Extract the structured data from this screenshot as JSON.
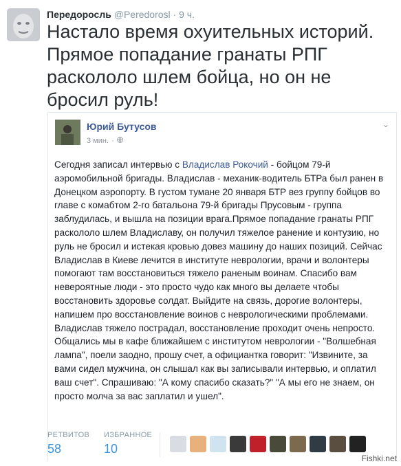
{
  "tweet": {
    "author_name": "Передоросль",
    "author_handle": "@Peredorosl",
    "separator": "·",
    "time": "9 ч.",
    "text": "Настало время охуительных историй. Прямое попадание гранаты РПГ раскололо шлем бойца, но он не бросил руль!"
  },
  "screenshot": {
    "author": "Юрий Бутусов",
    "time": "3 мин.",
    "dot": "·",
    "globe_icon": "globe-icon",
    "chevron": "⌄",
    "body_before_link": "Сегодня записал интервью с ",
    "link": "Владислав Рокочий",
    "body_after_link": " - бойцом 79-й аэромобильной бригады. Владислав - механик-водитель БТРа был ранен в Донецком аэропорту. В густом тумане 20 января БТР вез группу бойцов во главе с комабтом 2-го батальона 79-й бригады Прусовым - группа заблудилась, и вышла на позиции врага.Прямое попадание гранаты РПГ раскололо шлем Владиславу, он получил тяжелое ранение и контузию, но руль не бросил и истекая кровью довез машину до наших позиций. Сейчас Владислав в Киеве лечится в институте неврологии, врачи и волонтеры помогают там восстановиться тяжело раненым воинам. Спасибо вам невероятные люди - это просто чудо как много вы делаете чтобы восстановить здоровье солдат. Выйдите на связь, дорогие волонтеры, напишем про восстановление воинов с неврологическими проблемами. Владислав тяжело пострадал, восстановление проходит очень непросто. Общались мы в кафе ближайшем с институтом неврологии - \"Волшебная лампа\", поели заодно, прошу счет, а официантка говорит: \"Извините, за вами сидел мужчина, он слышал как вы записывали интервью, и оплатил ваш счет\". Спрашиваю: \"А кому спасибо сказать?\" \"А мы его не знаем, он просто молча за вас заплатил и ушел\"."
  },
  "stats": {
    "retweets_label": "РЕТВИТОВ",
    "retweets_value": "58",
    "favorites_label": "ИЗБРАННОЕ",
    "favorites_value": "10"
  },
  "fav_avatars": [
    {
      "icon": "avatar-1",
      "color": "#d9dde3"
    },
    {
      "icon": "avatar-2",
      "color": "#e8b07a"
    },
    {
      "icon": "avatar-3",
      "color": "#cfe3f0"
    },
    {
      "icon": "avatar-4",
      "color": "#3a3a3a"
    },
    {
      "icon": "avatar-5",
      "color": "#c0202a"
    },
    {
      "icon": "avatar-6",
      "color": "#4a4a3a"
    },
    {
      "icon": "avatar-7",
      "color": "#7c6a4f"
    },
    {
      "icon": "avatar-8",
      "color": "#2f3b45"
    },
    {
      "icon": "avatar-9",
      "color": "#5a4e40"
    },
    {
      "icon": "avatar-10",
      "color": "#222222"
    }
  ],
  "watermark": "Fishki.net",
  "colors": {
    "link": "#3b5998",
    "accent": "#3b94d9",
    "muted": "#8899a6"
  }
}
